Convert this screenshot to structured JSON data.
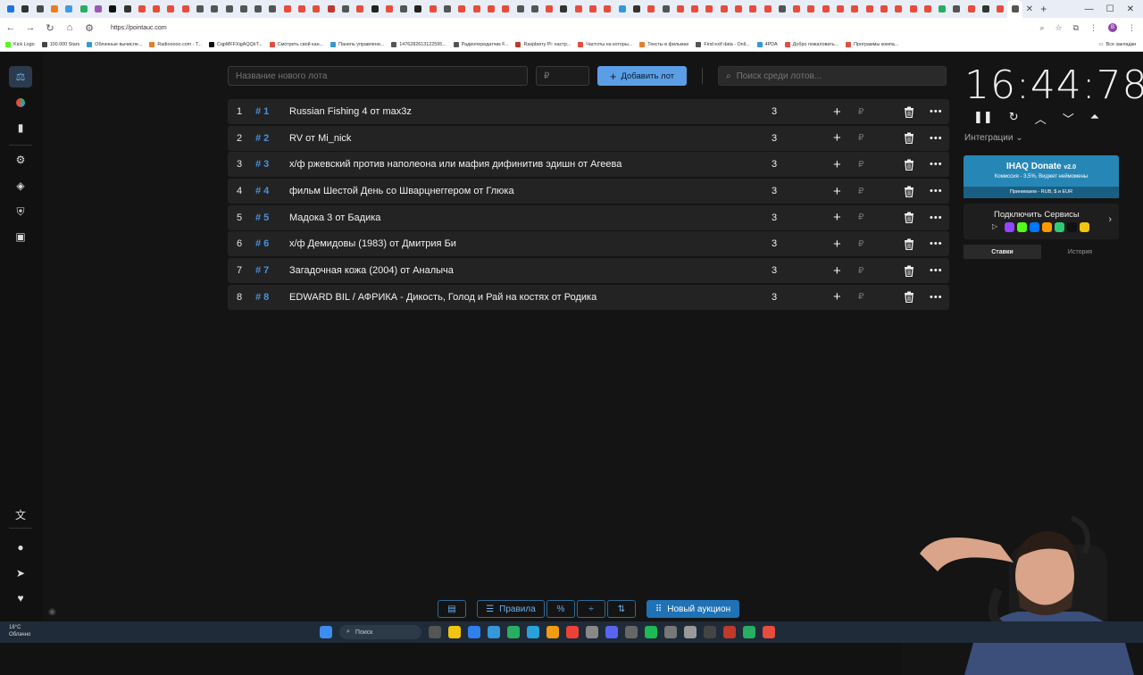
{
  "browser": {
    "url": "https://pointauc.com",
    "tab_colors": [
      "#1a73e8",
      "#333333",
      "#4a4a4a",
      "#e67e22",
      "#3d9be9",
      "#27ae60",
      "#9b59b6",
      "#111111",
      "#333333",
      "#e74c3c",
      "#e74c3c",
      "#e74c3c",
      "#e74c3c",
      "#555555",
      "#555555",
      "#555555",
      "#555555",
      "#555555",
      "#555555",
      "#e74c3c",
      "#e74c3c",
      "#e74c3c",
      "#c0392b",
      "#555555",
      "#e74c3c",
      "#222222",
      "#e74c3c",
      "#555555",
      "#222222",
      "#e74c3c",
      "#555555",
      "#e74c3c",
      "#e74c3c",
      "#e74c3c",
      "#e74c3c",
      "#555555",
      "#555555",
      "#e74c3c",
      "#333333",
      "#e74c3c",
      "#e74c3c",
      "#e74c3c",
      "#3498db",
      "#333333",
      "#e74c3c",
      "#555555",
      "#e74c3c",
      "#e74c3c",
      "#e74c3c",
      "#e74c3c",
      "#e74c3c",
      "#e74c3c",
      "#e74c3c",
      "#555555",
      "#e74c3c",
      "#e74c3c",
      "#e74c3c",
      "#e74c3c",
      "#e74c3c",
      "#e74c3c",
      "#e74c3c",
      "#e74c3c",
      "#e74c3c",
      "#e74c3c",
      "#27ae60",
      "#555555",
      "#e74c3c",
      "#333333",
      "#e74c3c",
      "#555555"
    ],
    "bookmarks": [
      {
        "label": "Kick Logo",
        "color": "#53fc18"
      },
      {
        "label": "100.000 Stars",
        "color": "#444444"
      },
      {
        "label": "Облачные вычисле...",
        "color": "#3498db"
      },
      {
        "label": "Radiooooo.com - T...",
        "color": "#e67e22"
      },
      {
        "label": "CqpMFFXigAQQkT...",
        "color": "#111111"
      },
      {
        "label": "Смотреть свой кан...",
        "color": "#e74c3c"
      },
      {
        "label": "Панель управлени...",
        "color": "#3498db"
      },
      {
        "label": "1476282613122595...",
        "color": "#555555"
      },
      {
        "label": "Радиопередатчик F...",
        "color": "#555555"
      },
      {
        "label": "Raspberry Pi: настр...",
        "color": "#c0392b"
      },
      {
        "label": "Частоты на которы...",
        "color": "#e74c3c"
      },
      {
        "label": "Тексты в фильмах",
        "color": "#e67e22"
      },
      {
        "label": "Find exif data - Onli...",
        "color": "#555555"
      },
      {
        "label": "4PDA",
        "color": "#3498db"
      },
      {
        "label": "Добро пожаловать...",
        "color": "#e74c3c"
      },
      {
        "label": "Программы компа...",
        "color": "#e74c3c"
      }
    ],
    "all_bookmarks": "Все закладки"
  },
  "form": {
    "name_placeholder": "Название нового лота",
    "price_placeholder": "₽",
    "add_label": "Добавить лот",
    "search_placeholder": "Поиск среди лотов..."
  },
  "lots": [
    {
      "num": "1",
      "id": "# 1",
      "title": "Russian Fishing 4 от max3z",
      "amount": "3"
    },
    {
      "num": "2",
      "id": "# 2",
      "title": "RV от Mi_nick",
      "amount": "3"
    },
    {
      "num": "3",
      "id": "# 3",
      "title": "х/ф ржевский против наполеона или мафия дифинитив эдишн от Агеева",
      "amount": "3"
    },
    {
      "num": "4",
      "id": "# 4",
      "title": " фильм Шестой День со Шварцнеггером от Глюка",
      "amount": "3"
    },
    {
      "num": "5",
      "id": "# 5",
      "title": "Мадока 3 от Бадика",
      "amount": "3"
    },
    {
      "num": "6",
      "id": "# 6",
      "title": "х/ф Демидовы (1983) от Дмитрия Би",
      "amount": "3"
    },
    {
      "num": "7",
      "id": "# 7",
      "title": "Загадочная кожа (2004) от Аналыча",
      "amount": "3"
    },
    {
      "num": "8",
      "id": "# 8",
      "title": "EDWARD BIL / АФРИКА - Дикость, Голод и Рай на костях от Родика",
      "amount": "3"
    }
  ],
  "lot_currency": "₽",
  "timer": {
    "value": "16:44:78"
  },
  "integrations": {
    "label": "Интеграции",
    "donate_title": "IHAQ Donate",
    "donate_version": "v2.0",
    "donate_sub": "Комиссия - 3,5%, Виджет неймомены",
    "donate_accept": "Принимаем - RUB, $ и EUR",
    "services_label": "Подключить Сервисы",
    "service_colors": [
      "#9146ff",
      "#53fc18",
      "#0077ff",
      "#ff9900",
      "#2ecc71",
      "#111111",
      "#f1c40f"
    ],
    "tabs": [
      "Ставки",
      "История"
    ]
  },
  "bottom": {
    "rules": "Правила",
    "new_auction": "Новый аукцион"
  },
  "taskbar": {
    "temp": "18°C",
    "weather": "Облачно",
    "search": "Поиск"
  }
}
